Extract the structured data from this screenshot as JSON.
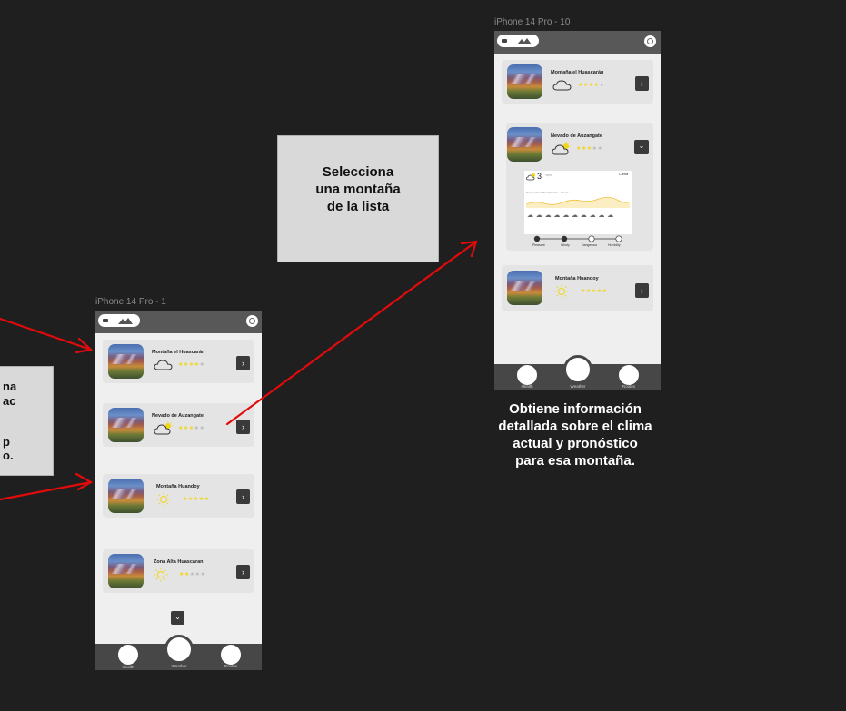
{
  "frames": {
    "left_label": "iPhone 14 Pro - 1",
    "right_label": "iPhone 14 Pro - 10"
  },
  "left_phone": {
    "cards": [
      {
        "name": "Montaña el Huascarán",
        "weather": "cloud-icon",
        "rating": 4
      },
      {
        "name": "Nevado de Auzangate",
        "weather": "partly-cloudy-icon",
        "rating": 3
      },
      {
        "name": "Montaña Huandoy",
        "weather": "sun-icon",
        "rating": 5
      },
      {
        "name": "Zona Alta Huascaran",
        "weather": "sun-icon",
        "rating": 2
      }
    ],
    "more_label": "⌄"
  },
  "right_phone": {
    "cards": [
      {
        "name": "Montaña el Huascarán",
        "weather": "cloud-icon",
        "rating": 4
      },
      {
        "name": "Nevado de Auzangate",
        "weather": "partly-cloudy-icon",
        "rating": 3
      },
      {
        "name": "Montaña Huandoy",
        "weather": "sun-icon",
        "rating": 5
      }
    ],
    "weather_panel": {
      "temp": "3",
      "unit": "°C|°F",
      "label": "Clima",
      "tabs": [
        "Temperatura",
        "Precipitación",
        "Viento"
      ],
      "statuses": [
        "Pleasant",
        "Windy",
        "Dangerous",
        "Humidity"
      ]
    }
  },
  "nav": {
    "health": "Health",
    "weather": "Weather",
    "routes": "Routes"
  },
  "notes": {
    "select": "Selecciona una montaña de la lista",
    "left_partial": [
      "na",
      "ac",
      "",
      "p",
      "o."
    ],
    "caption": "Obtiene información detallada sobre el clima actual y pronóstico para esa montaña."
  },
  "colors": {
    "bg": "#1f1f1f",
    "arrow": "#e10b0b",
    "star_on": "#f2d515",
    "star_off": "#b9b9b9",
    "topbar": "#585858",
    "navbar": "#474747"
  },
  "icons": {
    "search": "search-icon",
    "chevron_right": "chevron-right-icon",
    "chevron_down": "chevron-down-icon",
    "battery": "battery-icon",
    "logo": "mountain-logo-icon"
  }
}
